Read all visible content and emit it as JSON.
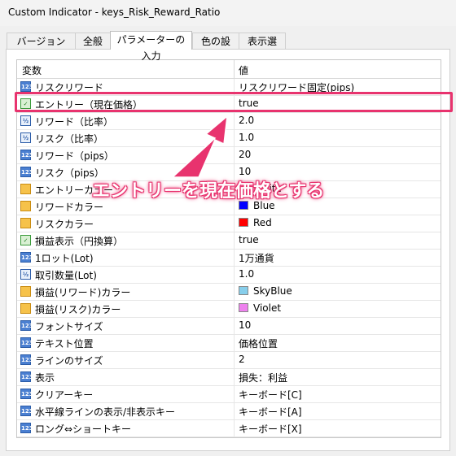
{
  "window": {
    "title": "Custom Indicator - keys_Risk_Reward_Ratio"
  },
  "tabs": [
    {
      "label": "バージョン情報"
    },
    {
      "label": "全般"
    },
    {
      "label": "パラメーターの入力"
    },
    {
      "label": "色の設定"
    },
    {
      "label": "表示選択"
    }
  ],
  "grid": {
    "col_variable": "変数",
    "col_value": "値",
    "rows": [
      {
        "icon": "int-icon",
        "label": "リスクリワード",
        "value": "リスクリワード固定(pips)"
      },
      {
        "icon": "bool-icon",
        "label": "エントリー（現在価格）",
        "value": "true"
      },
      {
        "icon": "double-icon",
        "label": "リワード（比率）",
        "value": "2.0"
      },
      {
        "icon": "double-icon",
        "label": "リスク（比率）",
        "value": "1.0"
      },
      {
        "icon": "int-icon",
        "label": "リワード（pips）",
        "value": "20"
      },
      {
        "icon": "int-icon",
        "label": "リスク（pips）",
        "value": "10"
      },
      {
        "icon": "color-icon",
        "label": "エントリーカラー",
        "value": "White",
        "swatch": "#ffffff"
      },
      {
        "icon": "color-icon",
        "label": "リワードカラー",
        "value": "Blue",
        "swatch": "#0000ff"
      },
      {
        "icon": "color-icon",
        "label": "リスクカラー",
        "value": "Red",
        "swatch": "#ff0000"
      },
      {
        "icon": "bool-icon",
        "label": "損益表示（円換算）",
        "value": "true"
      },
      {
        "icon": "int-icon",
        "label": "1ロット(Lot)",
        "value": "1万通貨"
      },
      {
        "icon": "double-icon",
        "label": "取引数量(Lot)",
        "value": "1.0"
      },
      {
        "icon": "color-icon",
        "label": "損益(リワード)カラー",
        "value": "SkyBlue",
        "swatch": "#87ceeb"
      },
      {
        "icon": "color-icon",
        "label": "損益(リスク)カラー",
        "value": "Violet",
        "swatch": "#ee82ee"
      },
      {
        "icon": "int-icon",
        "label": "フォントサイズ",
        "value": "10"
      },
      {
        "icon": "int-icon",
        "label": "テキスト位置",
        "value": "価格位置"
      },
      {
        "icon": "int-icon",
        "label": "ラインのサイズ",
        "value": "2"
      },
      {
        "icon": "int-icon",
        "label": "表示",
        "value": "損失：利益"
      },
      {
        "icon": "int-icon",
        "label": "クリアーキー",
        "value": "キーボード[C]"
      },
      {
        "icon": "int-icon",
        "label": "水平線ラインの表示/非表示キー",
        "value": "キーボード[A]"
      },
      {
        "icon": "int-icon",
        "label": "ロング⇔ショートキー",
        "value": "キーボード[X]"
      }
    ]
  },
  "annotation": {
    "text": "エントリーを現在価格とする",
    "color": "#e8336e"
  }
}
